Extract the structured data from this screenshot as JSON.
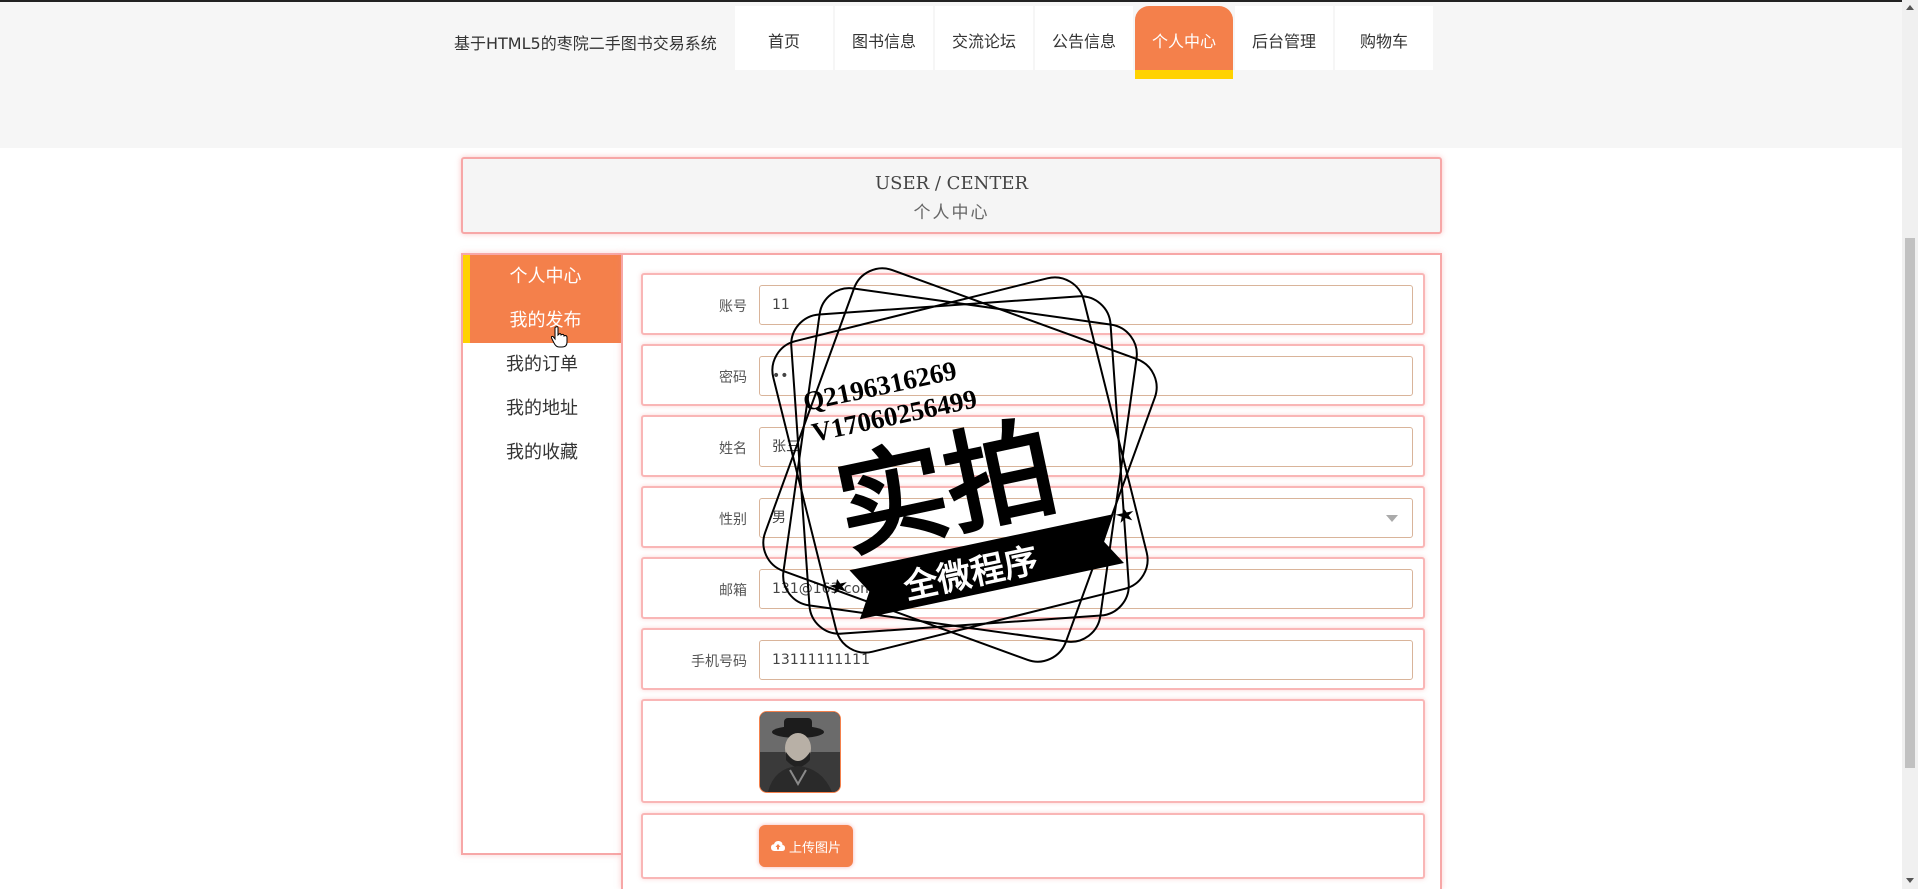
{
  "header": {
    "site_title": "基于HTML5的枣院二手图书交易系统",
    "nav": [
      {
        "label": "首页",
        "active": false
      },
      {
        "label": "图书信息",
        "active": false
      },
      {
        "label": "交流论坛",
        "active": false
      },
      {
        "label": "公告信息",
        "active": false
      },
      {
        "label": "个人中心",
        "active": true
      },
      {
        "label": "后台管理",
        "active": false
      },
      {
        "label": "购物车",
        "active": false
      }
    ]
  },
  "page_header": {
    "title_en": "USER / CENTER",
    "title_zh": "个人中心"
  },
  "sidebar": {
    "items": [
      {
        "label": "个人中心",
        "active": true
      },
      {
        "label": "我的发布",
        "active": true
      },
      {
        "label": "我的订单",
        "active": false
      },
      {
        "label": "我的地址",
        "active": false
      },
      {
        "label": "我的收藏",
        "active": false
      }
    ]
  },
  "form": {
    "fields": [
      {
        "label": "账号",
        "value": "11"
      },
      {
        "label": "密码",
        "value": "••"
      },
      {
        "label": "姓名",
        "value": "张三"
      },
      {
        "label": "性别",
        "value": "男"
      },
      {
        "label": "邮箱",
        "value": "131@163.com"
      },
      {
        "label": "手机号码",
        "value": "13111111111"
      }
    ],
    "upload_label": "上传图片"
  },
  "watermark": {
    "line1": "Q2196316269",
    "line2": "V17060256499",
    "big": "实拍",
    "banner": "全微程序"
  },
  "colors": {
    "accent": "#f4804b",
    "highlight": "#ffd200",
    "border": "#f7a7a7"
  }
}
